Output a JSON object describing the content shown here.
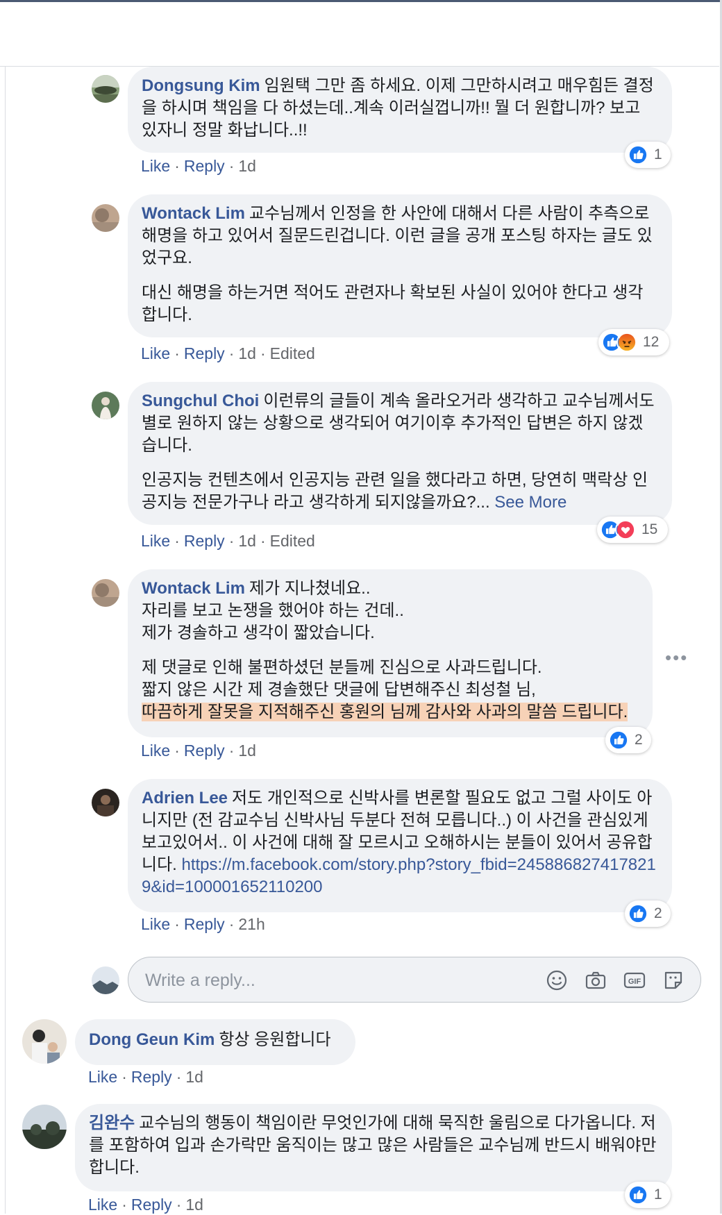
{
  "actions": {
    "like": "Like",
    "reply": "Reply",
    "edited": "Edited",
    "see_more": "See More"
  },
  "comments": [
    {
      "author": "Dongsung Kim",
      "paragraphs": [
        "임원택 그만 좀 하세요. 이제 그만하시려고 매우힘든 결정을 하시며 책임을 다 하셨는데..계속 이러실껍니까!! 뭘 더 원합니까? 보고 있자니 정말 화납니다..!!"
      ],
      "time": "1d",
      "reactions": {
        "icons": [
          "like"
        ],
        "count": "1"
      }
    },
    {
      "author": "Wontack Lim",
      "paragraphs": [
        "교수님께서 인정을 한 사안에 대해서 다른 사람이 추측으로 해명을 하고 있어서 질문드린겁니다. 이런 글을 공개 포스팅 하자는 글도 있었구요.",
        "대신 해명을 하는거면 적어도 관련자나 확보된 사실이 있어야 한다고 생각합니다."
      ],
      "time": "1d",
      "edited": true,
      "reactions": {
        "icons": [
          "like",
          "angry"
        ],
        "count": "12"
      }
    },
    {
      "author": "Sungchul Choi",
      "paragraphs": [
        "이런류의 글들이 계속 올라오거라 생각하고 교수님께서도 별로 원하지 않는 상황으로 생각되어 여기이후 추가적인 답변은 하지 않겠습니다.",
        "인공지능 컨텐츠에서 인공지능 관련 일을 했다라고 하면, 당연히 맥락상 인공지능 전문가구나 라고 생각하게 되지않을까요?..."
      ],
      "time": "1d",
      "edited": true,
      "reactions": {
        "icons": [
          "like",
          "love"
        ],
        "count": "15"
      }
    },
    {
      "author": "Wontack Lim",
      "paragraph1_lines": [
        "제가 지나쳤네요..",
        "자리를 보고 논쟁을 했어야 하는 건데..",
        "제가 경솔하고 생각이 짧았습니다."
      ],
      "paragraph2_lines": [
        "제 댓글로 인해 불편하셨던 분들께 진심으로 사과드립니다.",
        "짧지 않은 시간 제 경솔했단 댓글에 답변해주신 최성철 님,"
      ],
      "highlighted": "따끔하게 잘못을 지적해주신 홍원의 님께 감사와 사과의 말씀 드립니다.",
      "time": "1d",
      "reactions": {
        "icons": [
          "like"
        ],
        "count": "2"
      }
    },
    {
      "author": "Adrien Lee",
      "text": "저도 개인적으로 신박사를 변론할 필요도 없고 그럴 사이도 아니지만 (전 감교수님 신박사님 두분다 전혀 모릅니다..) 이 사건을 관심있게 보고있어서.. 이 사건에 대해 잘 모르시고 오해하시는 분들이 있어서 공유합니다.",
      "link": "https://m.facebook.com/story.php?story_fbid=2458868274178219&id=100001652110200",
      "time": "21h",
      "reactions": {
        "icons": [
          "like"
        ],
        "count": "2"
      }
    }
  ],
  "reply_box": {
    "placeholder": "Write a reply..."
  },
  "top_comments": [
    {
      "author": "Dong Geun Kim",
      "text": "항상 응원합니다",
      "time": "1d"
    },
    {
      "author": "김완수",
      "text": "교수님의 행동이 책임이란 무엇인가에 대해 묵직한 울림으로 다가옵니다. 저를 포함하여 입과 손가락만 움직이는 많고 많은 사람들은 교수님께 반드시 배워야만 합니다.",
      "time": "1d",
      "reactions": {
        "icons": [
          "like"
        ],
        "count": "1"
      }
    }
  ],
  "colors": {
    "link": "#385898",
    "bubble": "#f0f2f5",
    "meta": "#65676b",
    "highlight": "#f7d2b7",
    "like": "#1877f2"
  }
}
